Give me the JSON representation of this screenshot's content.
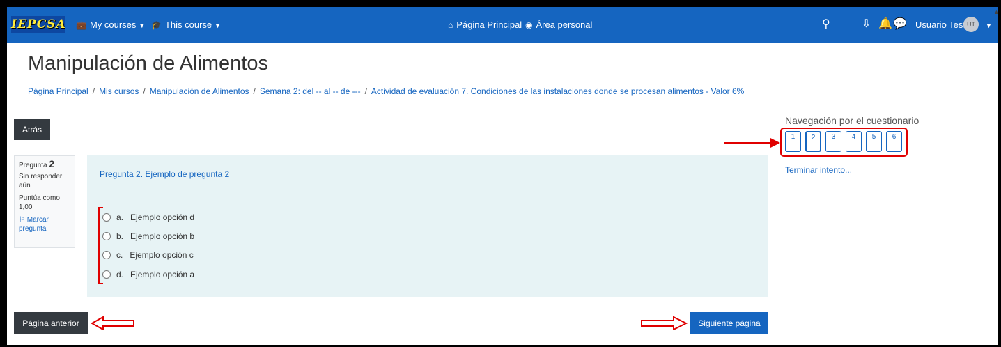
{
  "navbar": {
    "logo_text": "IEPCSA",
    "my_courses": "My courses",
    "this_course": "This course",
    "home": "Página Principal",
    "dashboard": "Área personal",
    "user_name": "Usuario Test",
    "avatar_initials": "UT"
  },
  "page": {
    "title": "Manipulación de Alimentos",
    "breadcrumb": [
      "Página Principal",
      "Mis cursos",
      "Manipulación de Alimentos",
      "Semana 2: del -- al -- de ---",
      "Actividad de evaluación 7. Condiciones de las instalaciones donde se procesan alimentos - Valor 6%"
    ],
    "back_button": "Atrás"
  },
  "question_info": {
    "label": "Pregunta",
    "number": "2",
    "status": "Sin responder aún",
    "score_label": "Puntúa como",
    "score_value": "1,00",
    "flag_label": "Marcar pregunta"
  },
  "question": {
    "text": "Pregunta 2. Ejemplo de pregunta 2",
    "options": [
      {
        "letter": "a.",
        "text": "Ejemplo opción d"
      },
      {
        "letter": "b.",
        "text": "Ejemplo opción b"
      },
      {
        "letter": "c.",
        "text": "Ejemplo opción c"
      },
      {
        "letter": "d.",
        "text": "Ejemplo opción a"
      }
    ]
  },
  "quiz_nav": {
    "heading": "Navegación por el cuestionario",
    "questions": [
      "1",
      "2",
      "3",
      "4",
      "5",
      "6"
    ],
    "current": "2",
    "finish_link": "Terminar intento..."
  },
  "footer_buttons": {
    "previous": "Página anterior",
    "next": "Siguiente página"
  },
  "colors": {
    "brand": "#1565c0",
    "annotation": "#e00000",
    "question_bg": "#e7f3f5"
  }
}
